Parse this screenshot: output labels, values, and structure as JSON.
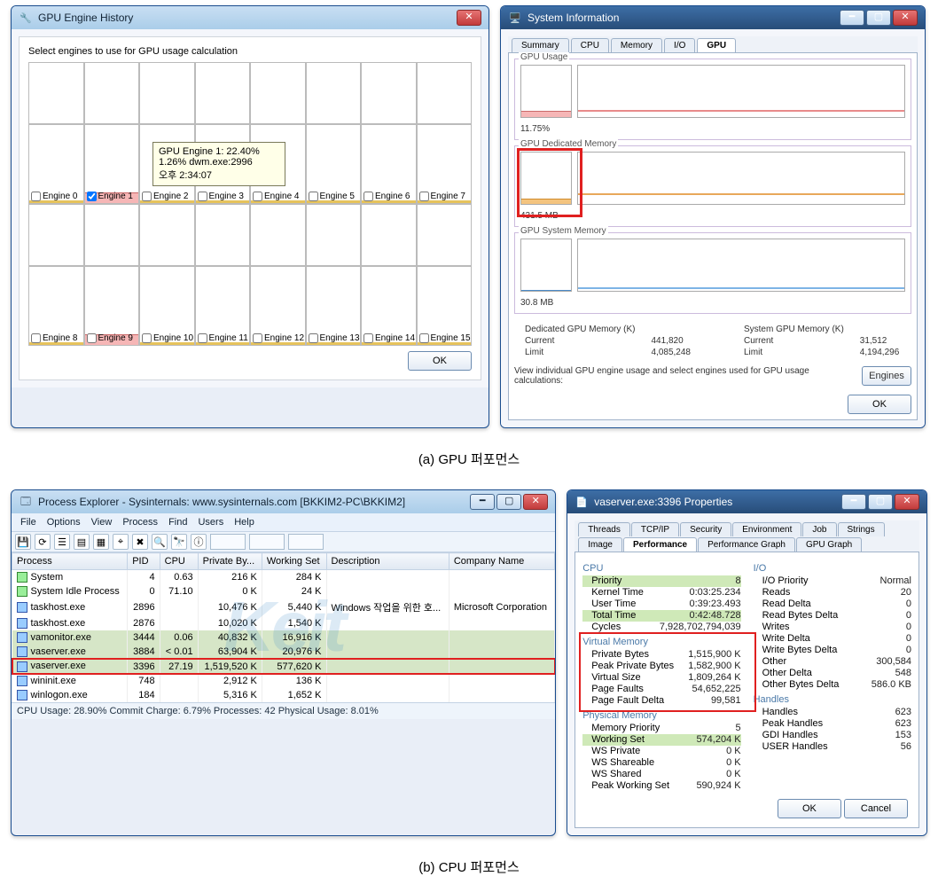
{
  "caption_a": "(a) GPU 퍼포먼스",
  "caption_b": "(b) CPU 퍼포먼스",
  "geh": {
    "title": "GPU Engine History",
    "subtitle": "Select engines to use for GPU usage calculation",
    "ok": "OK",
    "engines_row1": [
      "Engine 0",
      "Engine 1",
      "Engine 2",
      "Engine 3",
      "Engine 4",
      "Engine 5",
      "Engine 6",
      "Engine 7"
    ],
    "engines_row2": [
      "Engine 8",
      "Engine 9",
      "Engine 10",
      "Engine 11",
      "Engine 12",
      "Engine 13",
      "Engine 14",
      "Engine 15"
    ],
    "checked_index": 1,
    "tooltip": {
      "l1": "GPU Engine 1:  22.40%",
      "l2": "1.26% dwm.exe:2996",
      "l3": "오후 2:34:07"
    }
  },
  "si": {
    "title": "System Information",
    "tabs": [
      "Summary",
      "CPU",
      "Memory",
      "I/O",
      "GPU"
    ],
    "active_tab": 4,
    "groups": {
      "gpu_usage_label": "GPU Usage",
      "gpu_usage_value": "11.75%",
      "gpu_ded_label": "GPU Dedicated Memory",
      "gpu_ded_value": "431.5 MB",
      "gpu_sys_label": "GPU System Memory",
      "gpu_sys_value": "30.8 MB"
    },
    "mem": {
      "ded_label": "Dedicated GPU Memory (K)",
      "sys_label": "System GPU Memory (K)",
      "cur_label": "Current",
      "lim_label": "Limit",
      "ded_cur": "441,820",
      "ded_lim": "4,085,248",
      "sys_cur": "31,512",
      "sys_lim": "4,194,296"
    },
    "note": "View individual GPU engine usage and select engines used for GPU usage calculations:",
    "engines_btn": "Engines",
    "ok": "OK"
  },
  "pe": {
    "title": "Process Explorer - Sysinternals: www.sysinternals.com [BKKIM2-PC\\BKKIM2]",
    "menu": [
      "File",
      "Options",
      "View",
      "Process",
      "Find",
      "Users",
      "Help"
    ],
    "cols": [
      "Process",
      "PID",
      "CPU",
      "Private By...",
      "Working Set",
      "Description",
      "Company Name"
    ],
    "rows": [
      {
        "proc": "System",
        "pid": "4",
        "cpu": "0.63",
        "priv": "216 K",
        "ws": "284 K",
        "desc": "",
        "comp": "",
        "icon": "grn"
      },
      {
        "proc": "System Idle Process",
        "pid": "0",
        "cpu": "71.10",
        "priv": "0 K",
        "ws": "24 K",
        "desc": "",
        "comp": "",
        "icon": "grn"
      },
      {
        "proc": "taskhost.exe",
        "pid": "2896",
        "cpu": "",
        "priv": "10,476 K",
        "ws": "5,440 K",
        "desc": "Windows 작업을 위한 호...",
        "comp": "Microsoft Corporation",
        "icon": "blue"
      },
      {
        "proc": "taskhost.exe",
        "pid": "2876",
        "cpu": "",
        "priv": "10,020 K",
        "ws": "1,540 K",
        "desc": "",
        "comp": "",
        "icon": "blue"
      },
      {
        "proc": "vamonitor.exe",
        "pid": "3444",
        "cpu": "0.06",
        "priv": "40,832 K",
        "ws": "16,916 K",
        "desc": "",
        "comp": "",
        "icon": "blue",
        "hl": true
      },
      {
        "proc": "vaserver.exe",
        "pid": "3884",
        "cpu": "< 0.01",
        "priv": "63,904 K",
        "ws": "20,976 K",
        "desc": "",
        "comp": "",
        "icon": "blue",
        "hl": true
      },
      {
        "proc": "vaserver.exe",
        "pid": "3396",
        "cpu": "27.19",
        "priv": "1,519,520 K",
        "ws": "577,620 K",
        "desc": "",
        "comp": "",
        "icon": "blue",
        "hl": true,
        "red": true
      },
      {
        "proc": "wininit.exe",
        "pid": "748",
        "cpu": "",
        "priv": "2,912 K",
        "ws": "136 K",
        "desc": "",
        "comp": "",
        "icon": "blue"
      },
      {
        "proc": "winlogon.exe",
        "pid": "184",
        "cpu": "",
        "priv": "5,316 K",
        "ws": "1,652 K",
        "desc": "",
        "comp": "",
        "icon": "blue"
      }
    ],
    "status": "CPU Usage: 28.90%   Commit Charge: 6.79%   Processes: 42   Physical Usage: 8.01%"
  },
  "prop": {
    "title": "vaserver.exe:3396 Properties",
    "tabs_row1": [
      "Threads",
      "TCP/IP",
      "Security",
      "Environment",
      "Job",
      "Strings"
    ],
    "tabs_row2": [
      "Image",
      "Performance",
      "Performance Graph",
      "GPU Graph"
    ],
    "active_tab": "Performance",
    "cpu": {
      "heading": "CPU",
      "priority_l": "Priority",
      "priority_v": "8",
      "kernel_l": "Kernel Time",
      "kernel_v": "0:03:25.234",
      "user_l": "User Time",
      "user_v": "0:39:23.493",
      "total_l": "Total Time",
      "total_v": "0:42:48.728",
      "cycles_l": "Cycles",
      "cycles_v": "7,928,702,794,039"
    },
    "vmem": {
      "heading": "Virtual Memory",
      "pbytes_l": "Private Bytes",
      "pbytes_v": "1,515,900 K",
      "ppbytes_l": "Peak Private Bytes",
      "ppbytes_v": "1,582,900 K",
      "vsize_l": "Virtual Size",
      "vsize_v": "1,809,264 K",
      "pf_l": "Page Faults",
      "pf_v": "54,652,225",
      "pfd_l": "Page Fault Delta",
      "pfd_v": "99,581"
    },
    "pmem": {
      "heading": "Physical Memory",
      "mp_l": "Memory Priority",
      "mp_v": "5",
      "ws_l": "Working Set",
      "ws_v": "574,204 K",
      "wsp_l": "WS Private",
      "wsp_v": "0 K",
      "wss_l": "WS Shareable",
      "wss_v": "0 K",
      "wssh_l": "WS Shared",
      "wssh_v": "0 K",
      "pws_l": "Peak Working Set",
      "pws_v": "590,924 K"
    },
    "io": {
      "heading": "I/O",
      "iop_l": "I/O Priority",
      "iop_v": "Normal",
      "reads_l": "Reads",
      "reads_v": "20",
      "rd_l": "Read Delta",
      "rd_v": "0",
      "rbd_l": "Read Bytes Delta",
      "rbd_v": "0",
      "writes_l": "Writes",
      "writes_v": "0",
      "wd_l": "Write Delta",
      "wd_v": "0",
      "wbd_l": "Write Bytes Delta",
      "wbd_v": "0",
      "other_l": "Other",
      "other_v": "300,584",
      "od_l": "Other Delta",
      "od_v": "548",
      "obd_l": "Other Bytes Delta",
      "obd_v": "586.0 KB"
    },
    "handles": {
      "heading": "Handles",
      "h_l": "Handles",
      "h_v": "623",
      "ph_l": "Peak Handles",
      "ph_v": "623",
      "gdi_l": "GDI Handles",
      "gdi_v": "153",
      "user_l": "USER Handles",
      "user_v": "56"
    },
    "ok": "OK",
    "cancel": "Cancel"
  }
}
